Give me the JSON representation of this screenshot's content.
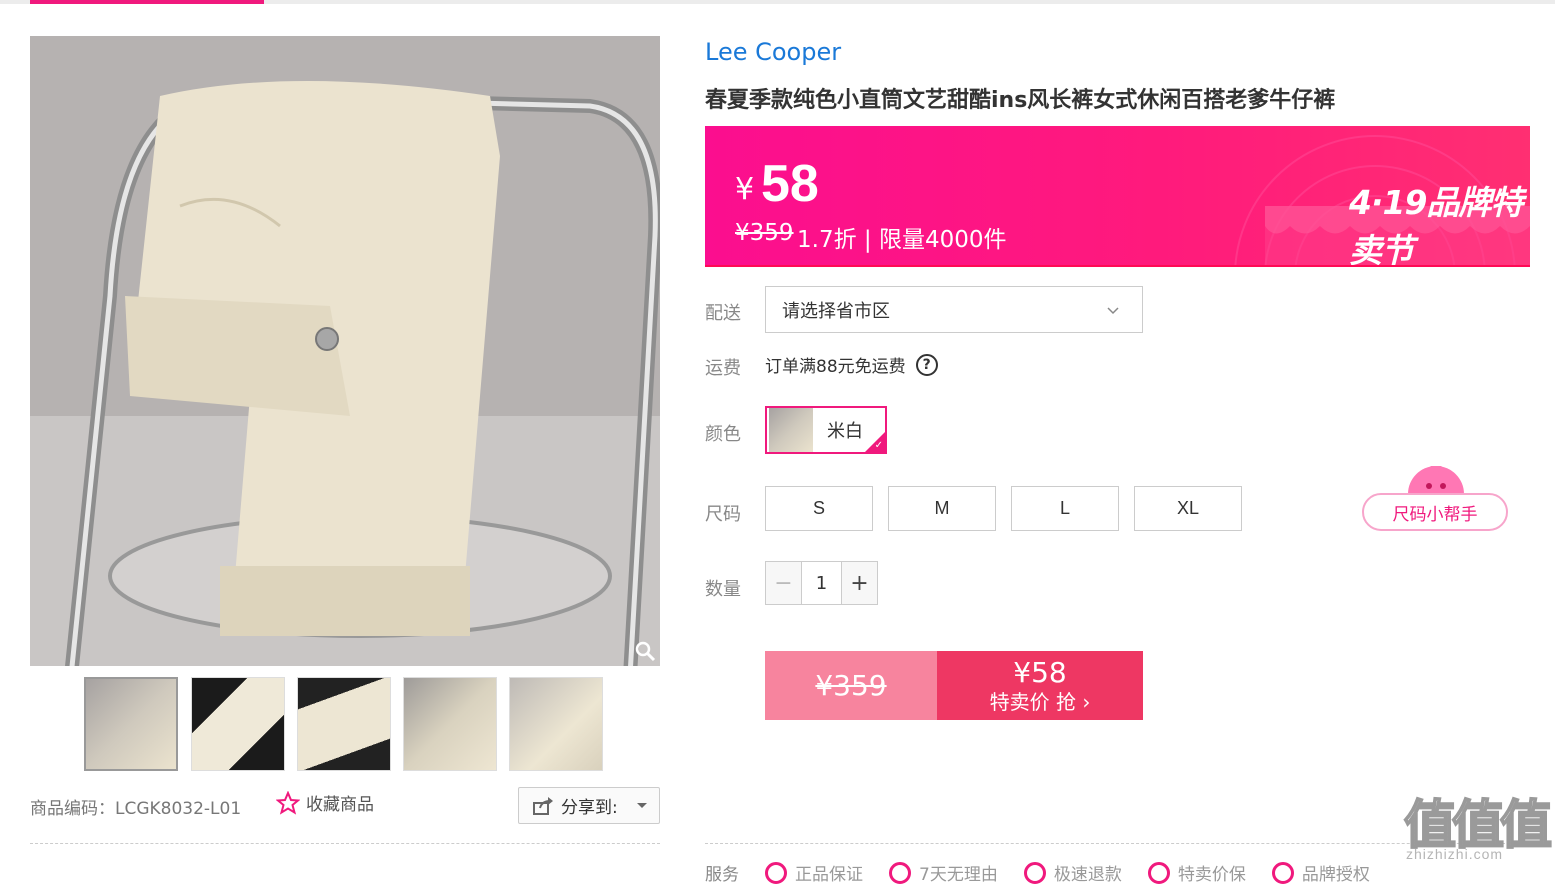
{
  "brand": "Lee Cooper",
  "title": "春夏季款纯色小直筒文艺甜酷ins风长裤女式休闲百搭老爹牛仔裤",
  "price": {
    "currency": "¥",
    "current": "58",
    "original": "¥359",
    "discount_info": "1.7折 | 限量4000件",
    "festival": "4·19品牌特卖节"
  },
  "delivery": {
    "label": "配送",
    "placeholder": "请选择省市区"
  },
  "shipping": {
    "label": "运费",
    "text": "订单满88元免运费",
    "help_icon": "?"
  },
  "color": {
    "label": "颜色",
    "options": [
      {
        "name": "米白",
        "selected": true
      }
    ]
  },
  "size": {
    "label": "尺码",
    "options": [
      "S",
      "M",
      "L",
      "XL"
    ],
    "helper": "尺码小帮手"
  },
  "quantity": {
    "label": "数量",
    "value": "1",
    "minus": "−",
    "plus": "+"
  },
  "buy": {
    "original": "¥359",
    "price": "¥58",
    "action": "特卖价 抢 ›"
  },
  "product_code": "商品编码：LCGK8032-L01",
  "favorite_label": "收藏商品",
  "share_label": "分享到:",
  "services": {
    "label": "服务",
    "items": [
      "正品保证",
      "7天无理由",
      "极速退款",
      "特卖价保",
      "品牌授权"
    ]
  },
  "watermark": {
    "logo": "值值值",
    "site": "zhizhizhi.com"
  },
  "colors": {
    "accent": "#f0197d",
    "brand_link": "#1a79d8",
    "buy_left": "#f7849e",
    "buy_right": "#ee3763"
  }
}
